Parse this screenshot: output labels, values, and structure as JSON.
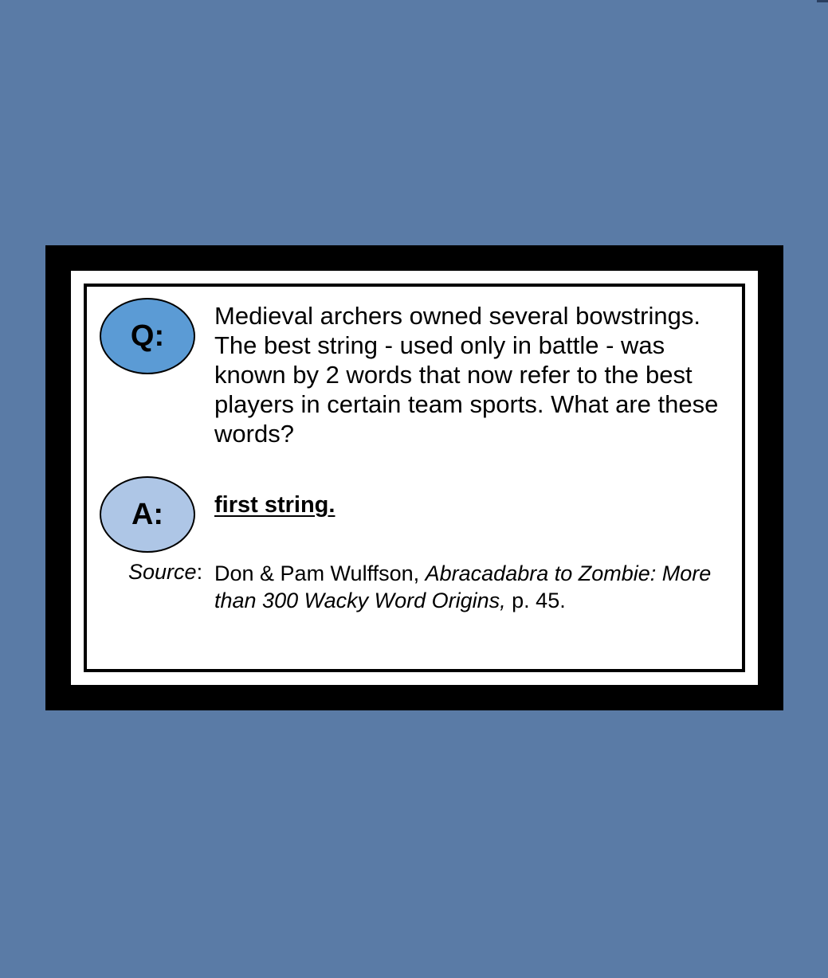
{
  "card": {
    "question_badge": "Q:",
    "question": "Medieval archers owned several bowstrings. The best string - used only in battle - was known by 2 words that now refer to the best players in certain team sports. What are these words?",
    "answer_badge": "A:",
    "answer": "first string.",
    "source_label": "Source",
    "source_colon": ":",
    "source_authors": "Don & Pam Wulffson, ",
    "source_title": "Abracadabra to Zombie: More than 300 Wacky Word Origins,",
    "source_page": " p. 45."
  },
  "colors": {
    "background": "#5a7ba6",
    "question_badge": "#5b9bd5",
    "answer_badge": "#aec6e6"
  }
}
